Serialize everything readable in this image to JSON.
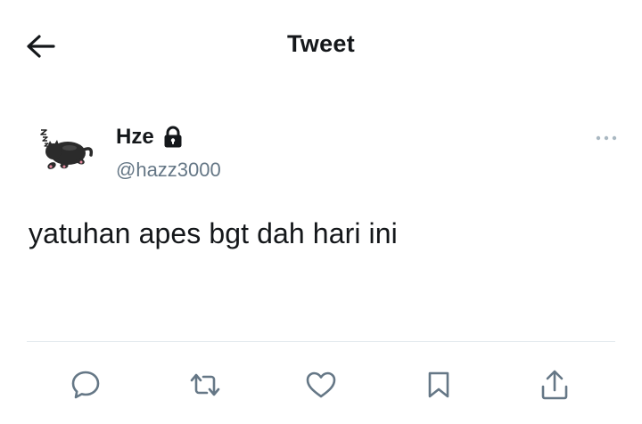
{
  "header": {
    "title": "Tweet",
    "back_icon": "arrow-left-icon"
  },
  "tweet": {
    "author": {
      "display_name": "Hze",
      "handle": "@hazz3000",
      "protected": true,
      "lock_icon": "lock-icon",
      "avatar": "sleeping-cat-avatar"
    },
    "text": "yatuhan apes bgt dah hari ini",
    "more_icon": "more-dots-icon"
  },
  "actions": [
    {
      "name": "reply",
      "icon": "reply-icon"
    },
    {
      "name": "retweet",
      "icon": "retweet-icon"
    },
    {
      "name": "like",
      "icon": "heart-icon"
    },
    {
      "name": "bookmark",
      "icon": "bookmark-icon"
    },
    {
      "name": "share",
      "icon": "share-icon"
    }
  ],
  "colors": {
    "text": "#14171a",
    "secondary": "#657786",
    "icon": "#657786",
    "divider": "#e1e8ed"
  }
}
